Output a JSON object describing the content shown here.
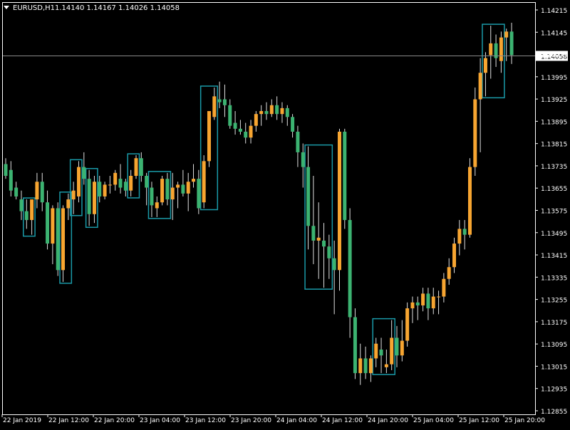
{
  "header": {
    "symbol": "EURUSD,H1",
    "ohlc": "1.14140 1.14167 1.14026 1.14058"
  },
  "colors": {
    "background": "#000000",
    "bull": "#f7a531",
    "bear": "#3cb371",
    "highlight_box": "#1a9aa8",
    "axis_text": "#ffffff",
    "frame": "#ffffff",
    "current_price_line": "#8a8a8a",
    "wick": "#e0e0e0"
  },
  "chart_data": {
    "type": "candlestick",
    "instrument": "EURUSD",
    "timeframe": "H1",
    "current_price": 1.14058,
    "ylim": [
      1.1284,
      1.1424
    ],
    "y_ticks": [
      "1.14215",
      "1.14145",
      "1.14075",
      "1.13995",
      "1.13925",
      "1.13895",
      "1.13815",
      "1.13735",
      "1.13655",
      "1.13575",
      "1.13495",
      "1.13415",
      "1.13335",
      "1.13255",
      "1.13175",
      "1.13095",
      "1.13015",
      "1.12935",
      "1.12855"
    ],
    "x_ticks": [
      "22 Jan 2019",
      "22 Jan 12:00",
      "22 Jan 20:00",
      "23 Jan 04:00",
      "23 Jan 12:00",
      "23 Jan 20:00",
      "24 Jan 04:00",
      "24 Jan 12:00",
      "24 Jan 20:00",
      "25 Jan 04:00",
      "25 Jan 12:00",
      "25 Jan 20:00"
    ],
    "candles": [
      [
        1.1369,
        1.1371,
        1.1364,
        1.1365
      ],
      [
        1.1367,
        1.137,
        1.1358,
        1.136
      ],
      [
        1.1361,
        1.1363,
        1.1357,
        1.1358
      ],
      [
        1.1357,
        1.136,
        1.135,
        1.1353
      ],
      [
        1.1353,
        1.1357,
        1.1347,
        1.135
      ],
      [
        1.135,
        1.1355,
        1.1345,
        1.1357
      ],
      [
        1.1357,
        1.1366,
        1.1354,
        1.1363
      ],
      [
        1.1363,
        1.1366,
        1.1353,
        1.1356
      ],
      [
        1.1356,
        1.136,
        1.134,
        1.1342
      ],
      [
        1.1342,
        1.1355,
        1.1335,
        1.1354
      ],
      [
        1.1354,
        1.1356,
        1.1331,
        1.1333
      ],
      [
        1.1333,
        1.1355,
        1.1329,
        1.1354
      ],
      [
        1.1354,
        1.1359,
        1.135,
        1.1357
      ],
      [
        1.1357,
        1.1363,
        1.1352,
        1.136
      ],
      [
        1.1358,
        1.137,
        1.1356,
        1.1368
      ],
      [
        1.1368,
        1.1373,
        1.1362,
        1.1364
      ],
      [
        1.1364,
        1.1367,
        1.1348,
        1.1352
      ],
      [
        1.1352,
        1.1365,
        1.1349,
        1.1363
      ],
      [
        1.1363,
        1.1365,
        1.1356,
        1.1358
      ],
      [
        1.1358,
        1.1363,
        1.1357,
        1.1362
      ],
      [
        1.1362,
        1.1365,
        1.1359,
        1.1362
      ],
      [
        1.1362,
        1.1367,
        1.136,
        1.1366
      ],
      [
        1.1364,
        1.1369,
        1.1359,
        1.1361
      ],
      [
        1.1363,
        1.1364,
        1.1358,
        1.136
      ],
      [
        1.136,
        1.1367,
        1.1358,
        1.1365
      ],
      [
        1.1365,
        1.1372,
        1.1364,
        1.1371
      ],
      [
        1.1371,
        1.1373,
        1.1363,
        1.1365
      ],
      [
        1.1365,
        1.1366,
        1.1355,
        1.1361
      ],
      [
        1.1361,
        1.1363,
        1.1351,
        1.1355
      ],
      [
        1.1354,
        1.1358,
        1.1351,
        1.1356
      ],
      [
        1.1356,
        1.1365,
        1.1355,
        1.1364
      ],
      [
        1.1364,
        1.1366,
        1.1355,
        1.1357
      ],
      [
        1.1357,
        1.1366,
        1.135,
        1.1361
      ],
      [
        1.1361,
        1.1363,
        1.1354,
        1.1362
      ],
      [
        1.1362,
        1.1367,
        1.1358,
        1.1359
      ],
      [
        1.1359,
        1.1366,
        1.1353,
        1.1363
      ],
      [
        1.1363,
        1.1369,
        1.1361,
        1.1364
      ],
      [
        1.1364,
        1.1367,
        1.1352,
        1.1354
      ],
      [
        1.1356,
        1.1372,
        1.1354,
        1.137
      ],
      [
        1.137,
        1.1385,
        1.1368,
        1.1387
      ],
      [
        1.1385,
        1.1395,
        1.1384,
        1.1392
      ],
      [
        1.1391,
        1.1397,
        1.1388,
        1.139
      ],
      [
        1.1391,
        1.1396,
        1.1385,
        1.1389
      ],
      [
        1.1389,
        1.1391,
        1.1381,
        1.1382
      ],
      [
        1.1383,
        1.1387,
        1.1379,
        1.1381
      ],
      [
        1.1381,
        1.1384,
        1.1379,
        1.138
      ],
      [
        1.138,
        1.1383,
        1.1376,
        1.1378
      ],
      [
        1.1378,
        1.1384,
        1.1376,
        1.1382
      ],
      [
        1.1382,
        1.1387,
        1.138,
        1.1386
      ],
      [
        1.1386,
        1.1389,
        1.1382,
        1.1387
      ],
      [
        1.1387,
        1.139,
        1.1384,
        1.1386
      ],
      [
        1.1386,
        1.1391,
        1.1385,
        1.1389
      ],
      [
        1.1389,
        1.1392,
        1.1384,
        1.1386
      ],
      [
        1.1386,
        1.139,
        1.1383,
        1.1388
      ],
      [
        1.1388,
        1.1389,
        1.1382,
        1.1385
      ],
      [
        1.1385,
        1.1386,
        1.1378,
        1.138
      ],
      [
        1.138,
        1.1382,
        1.1368,
        1.1373
      ],
      [
        1.1373,
        1.1376,
        1.1361,
        1.1368
      ],
      [
        1.1368,
        1.1375,
        1.134,
        1.1348
      ],
      [
        1.1348,
        1.1365,
        1.1335,
        1.1343
      ],
      [
        1.1343,
        1.1356,
        1.133,
        1.1344
      ],
      [
        1.1343,
        1.1349,
        1.1327,
        1.1341
      ],
      [
        1.1341,
        1.1345,
        1.133,
        1.1337
      ],
      [
        1.1337,
        1.1343,
        1.1318,
        1.1333
      ],
      [
        1.1333,
        1.1381,
        1.1326,
        1.138
      ],
      [
        1.138,
        1.1381,
        1.1347,
        1.135
      ],
      [
        1.135,
        1.1354,
        1.131,
        1.1317
      ],
      [
        1.1317,
        1.132,
        1.1296,
        1.1298
      ],
      [
        1.1298,
        1.1308,
        1.1294,
        1.1303
      ],
      [
        1.1303,
        1.1307,
        1.1296,
        1.1298
      ],
      [
        1.1298,
        1.1304,
        1.1295,
        1.1303
      ],
      [
        1.1303,
        1.131,
        1.13,
        1.1308
      ],
      [
        1.1306,
        1.131,
        1.1298,
        1.1304
      ],
      [
        1.13,
        1.1306,
        1.1298,
        1.1301
      ],
      [
        1.1301,
        1.1316,
        1.1299,
        1.131
      ],
      [
        1.131,
        1.1314,
        1.13,
        1.1304
      ],
      [
        1.1304,
        1.1316,
        1.1302,
        1.1309
      ],
      [
        1.1309,
        1.1322,
        1.1307,
        1.132
      ],
      [
        1.132,
        1.1324,
        1.1315,
        1.1322
      ],
      [
        1.1322,
        1.1324,
        1.1316,
        1.1321
      ],
      [
        1.1321,
        1.1327,
        1.1319,
        1.1325
      ],
      [
        1.1325,
        1.1327,
        1.1316,
        1.132
      ],
      [
        1.132,
        1.1327,
        1.1318,
        1.1324
      ],
      [
        1.1324,
        1.1326,
        1.1318,
        1.1324
      ],
      [
        1.1324,
        1.1332,
        1.1322,
        1.133
      ],
      [
        1.133,
        1.1337,
        1.1328,
        1.1334
      ],
      [
        1.1334,
        1.1344,
        1.1332,
        1.1342
      ],
      [
        1.1342,
        1.135,
        1.1338,
        1.1347
      ],
      [
        1.1347,
        1.135,
        1.134,
        1.1345
      ],
      [
        1.1345,
        1.1371,
        1.1344,
        1.1368
      ],
      [
        1.1368,
        1.1395,
        1.1365,
        1.1391
      ],
      [
        1.1391,
        1.1405,
        1.1373,
        1.14
      ],
      [
        1.14,
        1.1407,
        1.1392,
        1.1405
      ],
      [
        1.1406,
        1.1416,
        1.1398,
        1.141
      ],
      [
        1.141,
        1.1413,
        1.1402,
        1.1405
      ],
      [
        1.1404,
        1.1414,
        1.14,
        1.1412
      ],
      [
        1.1412,
        1.1415,
        1.1404,
        1.1414
      ],
      [
        1.1414,
        1.1417,
        1.1403,
        1.1406
      ]
    ],
    "highlighted_ranges": [
      [
        4,
        5
      ],
      [
        11,
        12
      ],
      [
        13,
        14
      ],
      [
        16,
        17
      ],
      [
        24,
        25
      ],
      [
        28,
        31
      ],
      [
        38,
        40
      ],
      [
        58,
        62
      ],
      [
        71,
        74
      ],
      [
        92,
        95
      ]
    ]
  }
}
